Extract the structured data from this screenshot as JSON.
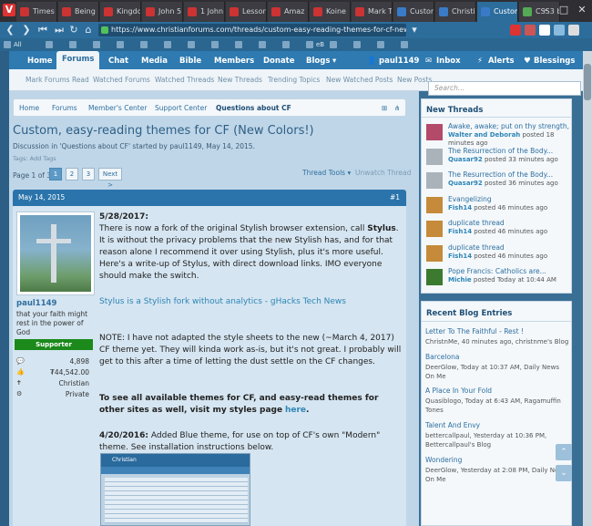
{
  "browser": {
    "tabs": [
      {
        "label": "Times",
        "color": "#c33"
      },
      {
        "label": "Being",
        "color": "#c33"
      },
      {
        "label": "Kingdo",
        "color": "#c33"
      },
      {
        "label": "John 5",
        "color": "#c33"
      },
      {
        "label": "1 John",
        "color": "#c33"
      },
      {
        "label": "Lesson",
        "color": "#c33"
      },
      {
        "label": "Amaz",
        "color": "#c33"
      },
      {
        "label": "Koine",
        "color": "#c33"
      },
      {
        "label": "Mark T",
        "color": "#c33"
      },
      {
        "label": "Custom",
        "color": "#3a7bc8"
      },
      {
        "label": "Christi",
        "color": "#3a7bc8"
      },
      {
        "label": "Custom",
        "color": "#3a7bc8"
      },
      {
        "label": "CSS3 b",
        "color": "#5a5"
      }
    ],
    "url": "https://www.christianforums.com/threads/custom-easy-reading-themes-for-cf-new-colors.7880077/",
    "bookmarks": [
      "All",
      "",
      "",
      "",
      "",
      "",
      "",
      "",
      "",
      "",
      "",
      "",
      "eB",
      "",
      "",
      "",
      ""
    ]
  },
  "nav": {
    "items": [
      "Home",
      "Forums",
      "Chat",
      "Media",
      "Bible",
      "Members",
      "Donate",
      "Blogs"
    ],
    "user": "paul1149",
    "inbox": "Inbox",
    "alerts": "Alerts",
    "blessings": "Blessings"
  },
  "subnav": {
    "links": [
      "Mark Forums Read",
      "Watched Forums",
      "Watched Threads",
      "New Threads",
      "Trending Topics",
      "New Watched Posts",
      "New Posts"
    ],
    "search_placeholder": "Search..."
  },
  "breadcrumb": [
    "Home",
    "Forums",
    "Member's Center",
    "Support Center",
    "Questions about CF"
  ],
  "thread": {
    "title": "Custom, easy-reading themes for CF (New Colors!)",
    "meta": "Discussion in 'Questions about CF' started by paul1149, May 14, 2015.",
    "tags": "Tags: Add Tags",
    "page_label": "Page 1 of 3",
    "pages": [
      "1",
      "2",
      "3",
      "Next >"
    ],
    "thread_tools": "Thread Tools",
    "unwatch": "Unwatch Thread"
  },
  "post": {
    "date": "May 14, 2015",
    "number": "#1",
    "author": "paul1149",
    "author_title": "that your faith might rest in the power of God",
    "badge": "Supporter",
    "stats": [
      {
        "icon": "💬",
        "value": "4,898"
      },
      {
        "icon": "👍",
        "value": "₮44,542.00"
      },
      {
        "icon": "✝",
        "value": "Christian"
      },
      {
        "icon": "⚙",
        "value": "Private"
      }
    ],
    "p1_date": "5/28/2017:",
    "p1_text_a": "There is now a fork of the original Stylish browser extension, call",
    "p1_stylus": "Stylus",
    "p1_text_b": ". It is without the privacy problems that the new Stylish has, and for that reason alone I recommend it over using Stylish, plus it's more useful. Here's a write-up of Stylus, with direct download links. IMO everyone should make the switch.",
    "p1_link": "Stylus is a Stylish fork without analytics - gHacks Tech News",
    "p2_text": "NOTE: I have not adapted the style sheets to the new (~March 4, 2017) CF theme yet. They will kinda work as-is, but it's not great. I probably will get to this after a time of letting the dust settle on the CF changes.",
    "p3_text": "To see all available themes for CF, and easy-read themes for other sites as well, visit my styles page",
    "p3_link": "here",
    "p4_date": "4/20/2016:",
    "p4_text": "Added Blue theme, for use on top of CF's own \"Modern\" theme. See installation instructions below.",
    "screenshot_caption": "Christian"
  },
  "sidebar": {
    "new_threads_title": "New Threads",
    "new_threads": [
      {
        "title": "Awake, awake; put on thy strength,",
        "meta_a": "Walter and Deborah",
        "meta_b": " posted 18 minutes ago",
        "color": "#b44a6a"
      },
      {
        "title": "The Resurrection of the Body...",
        "meta_a": "Quasar92",
        "meta_b": " posted 33 minutes ago",
        "color": "#aab3b9"
      },
      {
        "title": "The Resurrection of the Body...",
        "meta_a": "Quasar92",
        "meta_b": " posted 36 minutes ago",
        "color": "#aab3b9"
      },
      {
        "title": "Evangelizing",
        "meta_a": "Fish14",
        "meta_b": " posted 46 minutes ago",
        "color": "#c58a3a"
      },
      {
        "title": "duplicate thread",
        "meta_a": "Fish14",
        "meta_b": " posted 46 minutes ago",
        "color": "#c58a3a"
      },
      {
        "title": "duplicate thread",
        "meta_a": "Fish14",
        "meta_b": " posted 46 minutes ago",
        "color": "#c58a3a"
      },
      {
        "title": "Pope Francis: Catholics are...",
        "meta_a": "Michie",
        "meta_b": " posted Today at 10:44 AM",
        "color": "#3b7a2f"
      }
    ],
    "blog_title": "Recent Blog Entries",
    "blogs": [
      {
        "title": "Letter To The Faithful - Rest !",
        "meta": "ChristnMe, 40 minutes ago, christnme's Blog"
      },
      {
        "title": "Barcelona",
        "meta": "DeerGlow, Today at 10:37 AM, Daily News On Me"
      },
      {
        "title": "A Place In Your Fold",
        "meta": "Quasiblogo, Today at 6:43 AM, Ragamuffin Tones"
      },
      {
        "title": "Talent And Envy",
        "meta": "bettercallpaul, Yesterday at 10:36 PM, Bettercallpaul's Blog"
      },
      {
        "title": "Wondering",
        "meta": "DeerGlow, Yesterday at 2:08 PM, Daily News On Me"
      }
    ]
  }
}
